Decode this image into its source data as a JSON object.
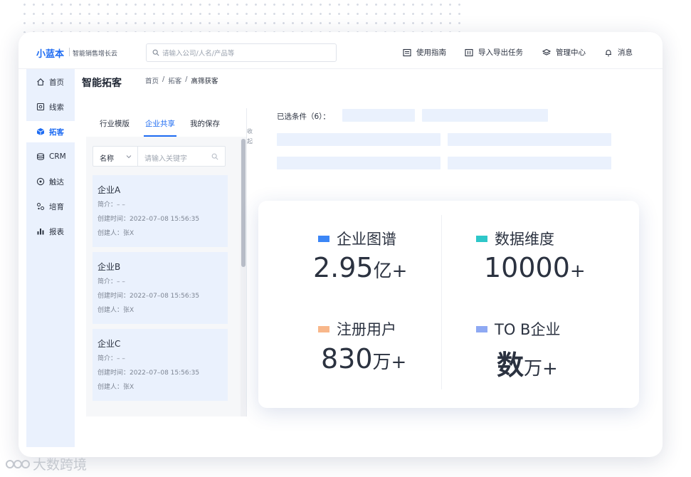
{
  "app": {
    "logo_text": "小蓝本",
    "tagline": "智能销售增长云",
    "search_placeholder": "请输入公司/人名/产品等"
  },
  "topnav": [
    {
      "label": "使用指南",
      "icon": "guide-icon"
    },
    {
      "label": "导入导出任务",
      "icon": "import-export-icon"
    },
    {
      "label": "管理中心",
      "icon": "layers-icon"
    },
    {
      "label": "消息",
      "icon": "bell-icon"
    }
  ],
  "sidebar": {
    "items": [
      {
        "label": "首页",
        "icon": "home-icon"
      },
      {
        "label": "线索",
        "icon": "clue-icon"
      },
      {
        "label": "拓客",
        "icon": "cube-icon",
        "active": true
      },
      {
        "label": "CRM",
        "icon": "crm-icon"
      },
      {
        "label": "触达",
        "icon": "target-icon"
      },
      {
        "label": "培育",
        "icon": "nurture-icon"
      },
      {
        "label": "报表",
        "icon": "chart-icon"
      }
    ]
  },
  "page": {
    "title": "智能拓客",
    "breadcrumb": [
      "首页",
      "/",
      "拓客",
      "/",
      "高筛获客"
    ]
  },
  "panel": {
    "tabs": [
      "行业模版",
      "企业共享",
      "我的保存"
    ],
    "active_tab": "企业共享",
    "keyword_field": "名称",
    "keyword_placeholder": "请输入关键字",
    "collapse_label": "收起",
    "cards": [
      {
        "name": "企业A",
        "intro": "简介：– –",
        "created": "创建时间：2022–07–08 15:56:35",
        "creator": "创建人：张X"
      },
      {
        "name": "企业B",
        "intro": "简介：– –",
        "created": "创建时间：2022–07–08 15:56:35",
        "creator": "创建人：张X"
      },
      {
        "name": "企业C",
        "intro": "简介：– –",
        "created": "创建时间：2022–07–08 15:56:35",
        "creator": "创建人：张X"
      }
    ]
  },
  "conditions": {
    "label": "已选条件（6）："
  },
  "stats": [
    {
      "label": "企业图谱",
      "value": "2.95",
      "unit": "亿+",
      "color": "#3b86f6"
    },
    {
      "label": "数据维度",
      "value": "10000",
      "unit": "+",
      "color": "#2ec7c9"
    },
    {
      "label": "注册用户",
      "value": "830",
      "unit": "万+",
      "color": "#f8b78a"
    },
    {
      "label": "TO B企业",
      "value": "数",
      "unit": "万+",
      "color": "#8ea9f3"
    }
  ],
  "watermark": "大数跨境",
  "colors": {
    "accent": "#1d6bf2",
    "sidebar_bg": "#eaf1fd",
    "card_bg": "#eaf1fd"
  }
}
